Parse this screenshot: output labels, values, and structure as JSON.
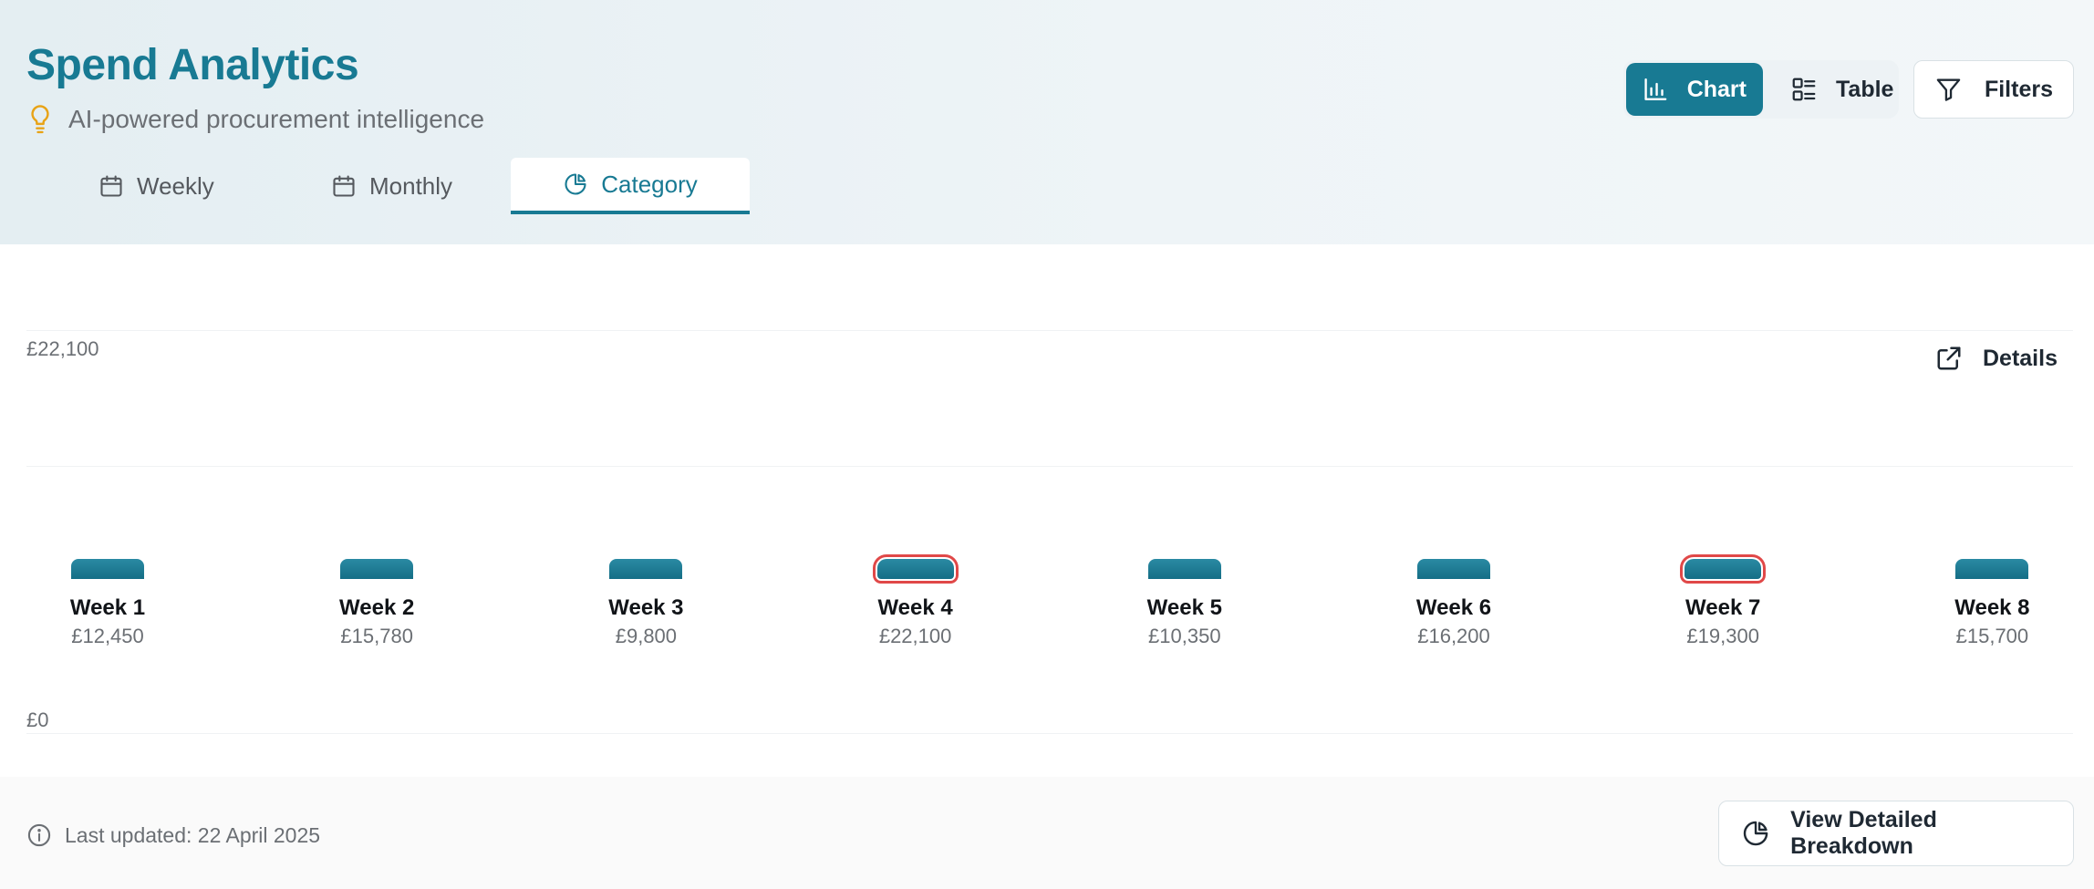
{
  "header": {
    "title": "Spend Analytics",
    "subtitle": "AI-powered procurement intelligence",
    "subtitle_icon": "lightbulb-icon"
  },
  "tabs": [
    {
      "label": "Weekly",
      "icon": "calendar-icon",
      "active": false
    },
    {
      "label": "Monthly",
      "icon": "calendar-icon",
      "active": false
    },
    {
      "label": "Category",
      "icon": "pie-chart-icon",
      "active": true
    }
  ],
  "view_toggle": {
    "chart_label": "Chart",
    "table_label": "Table",
    "selected": "Chart"
  },
  "filters_label": "Filters",
  "details_label": "Details",
  "chart_data": {
    "type": "bar",
    "y_ticks": [
      "£22,100",
      "£0"
    ],
    "ylim": [
      0,
      22100
    ],
    "grid": true,
    "categories": [
      "Week 1",
      "Week 2",
      "Week 3",
      "Week 4",
      "Week 5",
      "Week 6",
      "Week 7",
      "Week 8"
    ],
    "value_labels": [
      "£12,450",
      "£15,780",
      "£9,800",
      "£22,100",
      "£10,350",
      "£16,200",
      "£19,300",
      "£15,700"
    ],
    "values": [
      12450,
      15780,
      9800,
      22100,
      10350,
      16200,
      19300,
      15700
    ],
    "highlighted": [
      false,
      false,
      false,
      true,
      false,
      false,
      true,
      false
    ]
  },
  "footer": {
    "last_updated": "Last updated: 22 April 2025",
    "breakdown_label": "View Detailed Breakdown"
  },
  "colors": {
    "accent": "#187a93",
    "highlight_outline": "#e04848",
    "subtitle_icon": "#e8a317"
  }
}
